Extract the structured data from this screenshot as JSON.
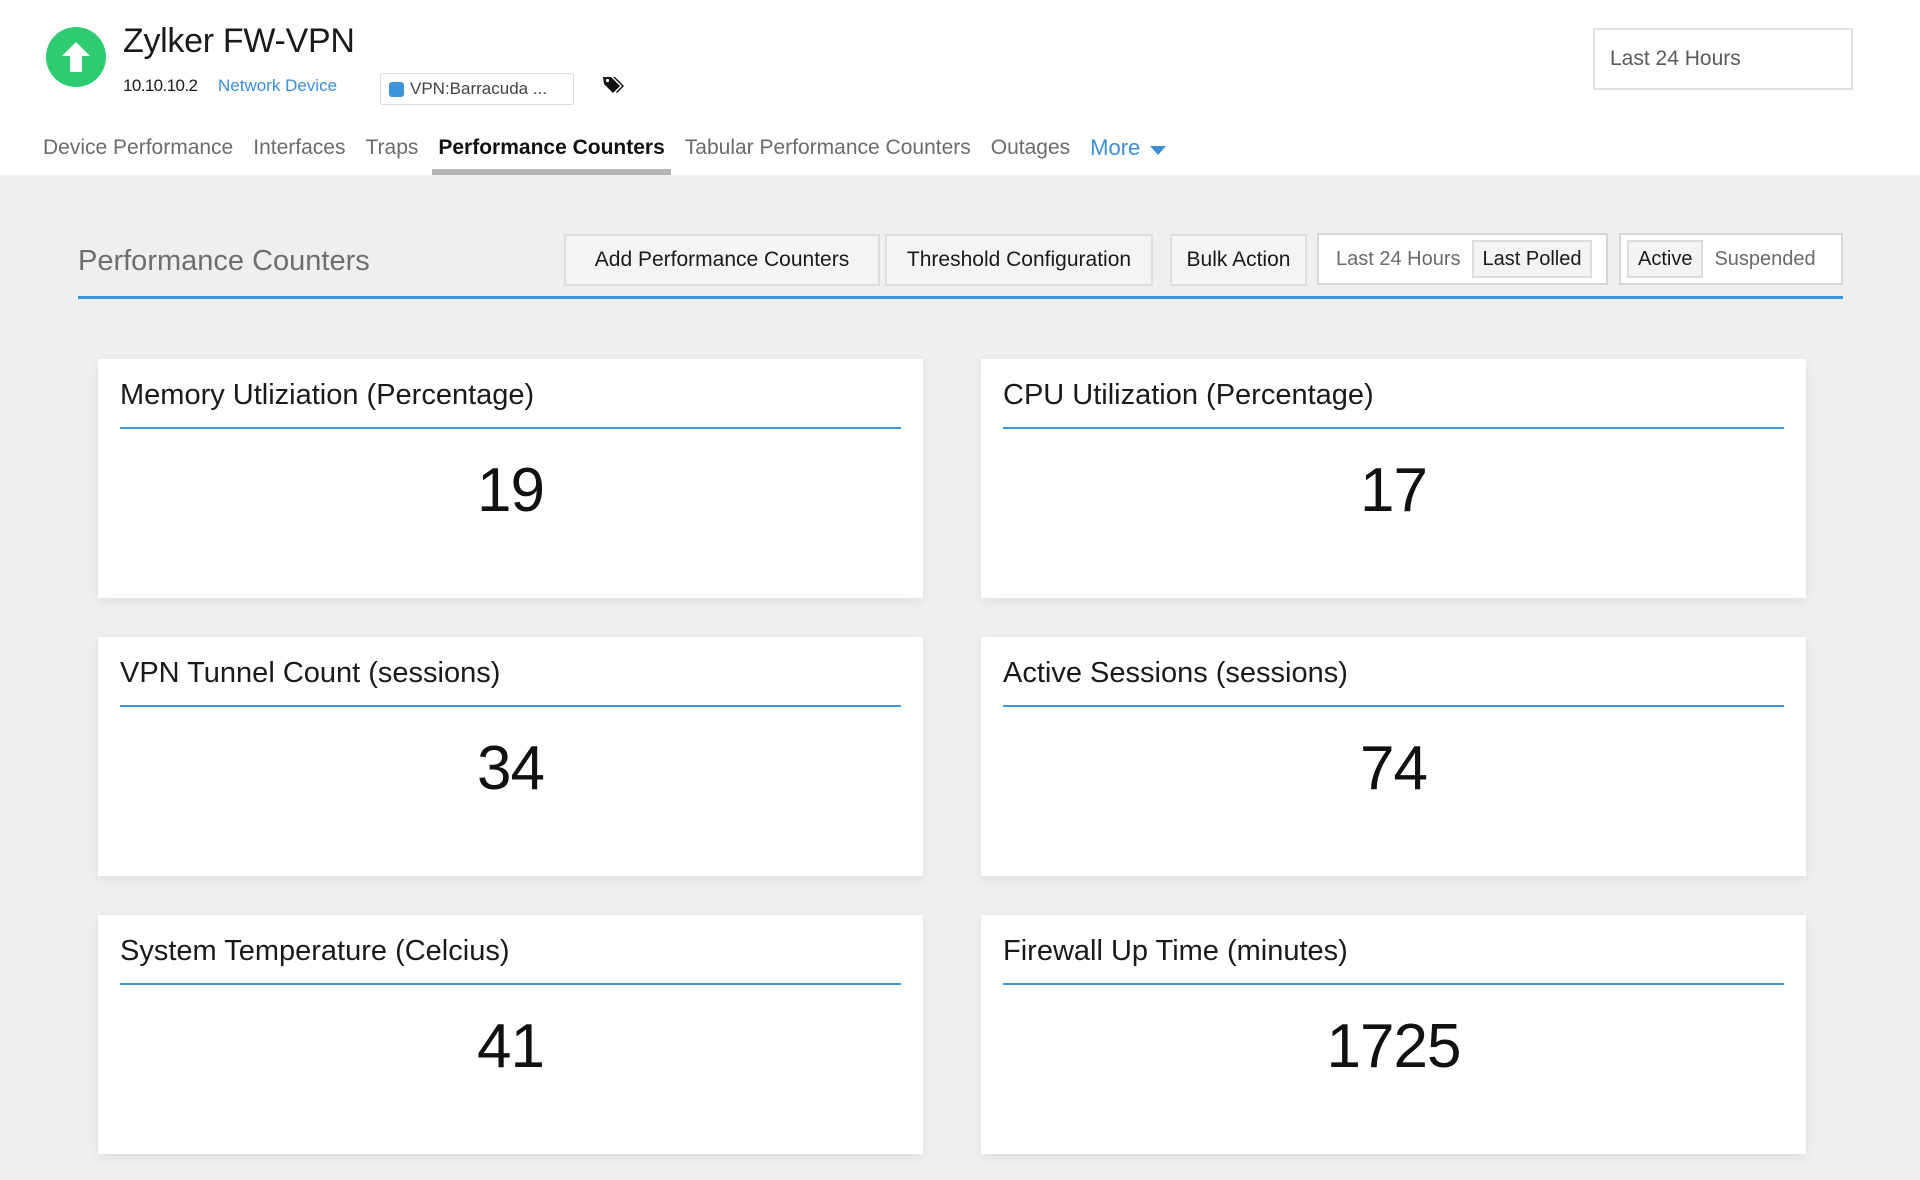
{
  "device": {
    "name": "Zylker FW-VPN",
    "ip": "10.10.10.2",
    "type": "Network Device",
    "tag": "VPN:Barracuda ...",
    "status": "up",
    "status_color": "#2ecc71"
  },
  "time_range": {
    "value": "Last 24 Hours"
  },
  "tabs": [
    {
      "label": "Device Performance",
      "active": false
    },
    {
      "label": "Interfaces",
      "active": false
    },
    {
      "label": "Traps",
      "active": false
    },
    {
      "label": "Performance Counters",
      "active": true
    },
    {
      "label": "Tabular Performance Counters",
      "active": false
    },
    {
      "label": "Outages",
      "active": false
    },
    {
      "label": "More",
      "active": false
    }
  ],
  "section": {
    "title": "Performance Counters",
    "buttons": {
      "add": "Add Performance Counters",
      "threshold": "Threshold Configuration",
      "bulk": "Bulk Action"
    },
    "time_toggle": {
      "options": [
        "Last 24 Hours",
        "Last Polled"
      ],
      "selected": "Last Polled"
    },
    "state_toggle": {
      "options": [
        "Active",
        "Suspended"
      ],
      "selected": "Active"
    }
  },
  "counters": [
    {
      "title": "Memory Utliziation (Percentage)",
      "value": "19"
    },
    {
      "title": "CPU Utilization (Percentage)",
      "value": "17"
    },
    {
      "title": "VPN Tunnel Count (sessions)",
      "value": "34"
    },
    {
      "title": "Active Sessions (sessions)",
      "value": "74"
    },
    {
      "title": "System Temperature (Celcius)",
      "value": "41"
    },
    {
      "title": "Firewall Up Time (minutes)",
      "value": "1725"
    }
  ],
  "colors": {
    "accent": "#3d95dc",
    "link": "#3d8fd8",
    "background": "#eeeff1"
  }
}
